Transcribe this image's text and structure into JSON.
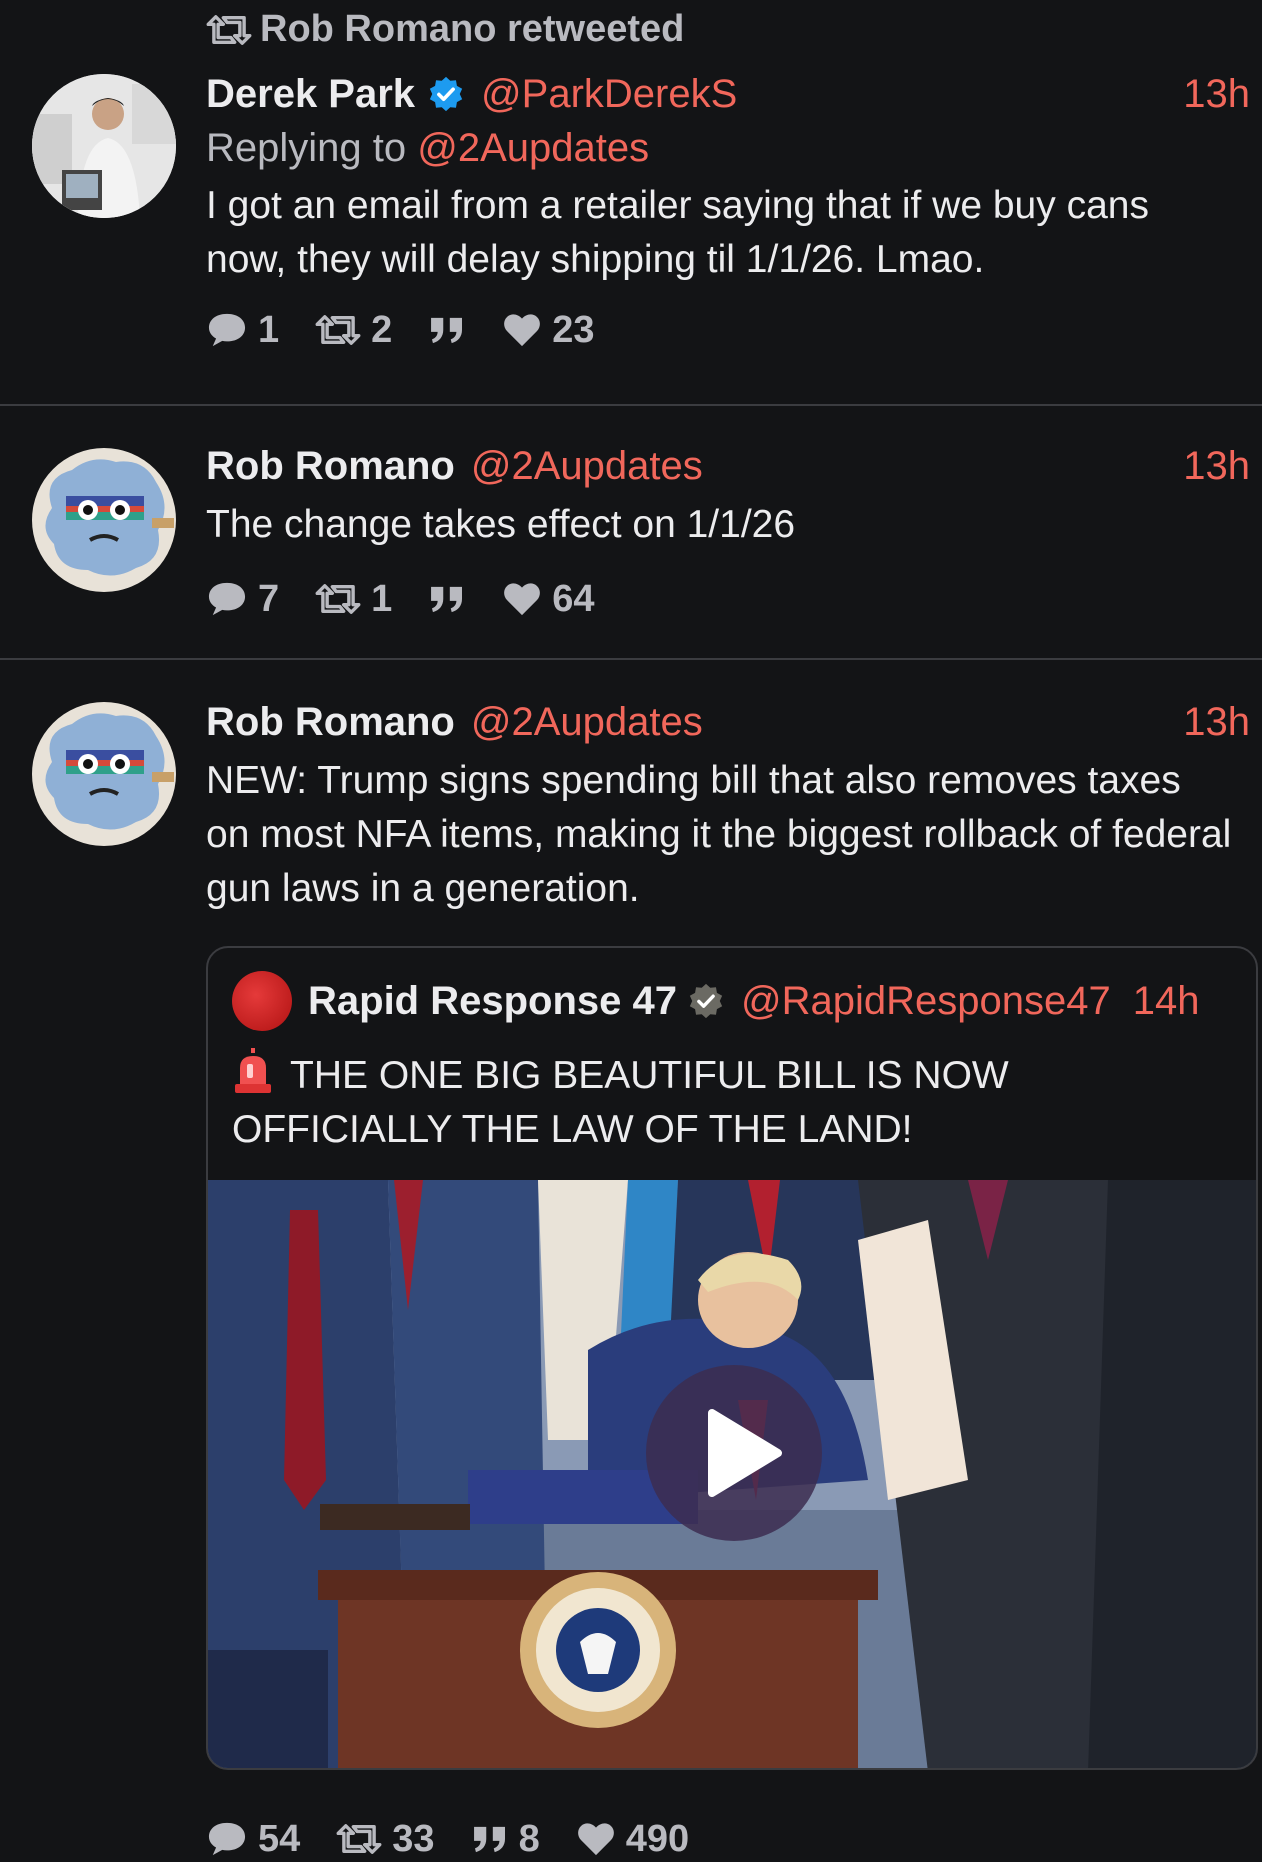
{
  "retweet_banner": {
    "text": "Rob Romano retweeted"
  },
  "tweets": [
    {
      "name": "Derek Park",
      "handle": "@ParkDerekS",
      "time": "13h",
      "reply_prefix": "Replying to ",
      "reply_handle": "@2Aupdates",
      "text": "I got an email from a retailer saying that if we buy cans now, they will delay shipping til 1/1/26. Lmao.",
      "replies": "1",
      "retweets": "2",
      "likes": "23"
    },
    {
      "name": "Rob Romano",
      "handle": "@2Aupdates",
      "time": "13h",
      "text": "The change takes effect on 1/1/26",
      "replies": "7",
      "retweets": "1",
      "likes": "64"
    },
    {
      "name": "Rob Romano",
      "handle": "@2Aupdates",
      "time": "13h",
      "text": "NEW: Trump signs spending bill that also removes taxes on most NFA items, making it the biggest rollback of federal gun laws in a generation.",
      "replies": "54",
      "retweets": "33",
      "quotes": "8",
      "likes": "490",
      "quoted": {
        "name": "Rapid Response 47",
        "handle": "@RapidResponse47",
        "time": "14h",
        "text": "THE ONE BIG BEAUTIFUL BILL IS NOW OFFICIALLY THE LAW OF THE LAND!",
        "media": "video"
      }
    }
  ],
  "colors": {
    "background": "#131416",
    "accent": "#f1675b",
    "verified_blue": "#1d9bf0",
    "muted": "#b9bac0"
  },
  "icons": [
    "retweet-icon",
    "verified-icon",
    "reply-icon",
    "quote-icon",
    "like-icon",
    "siren-icon",
    "play-icon"
  ]
}
